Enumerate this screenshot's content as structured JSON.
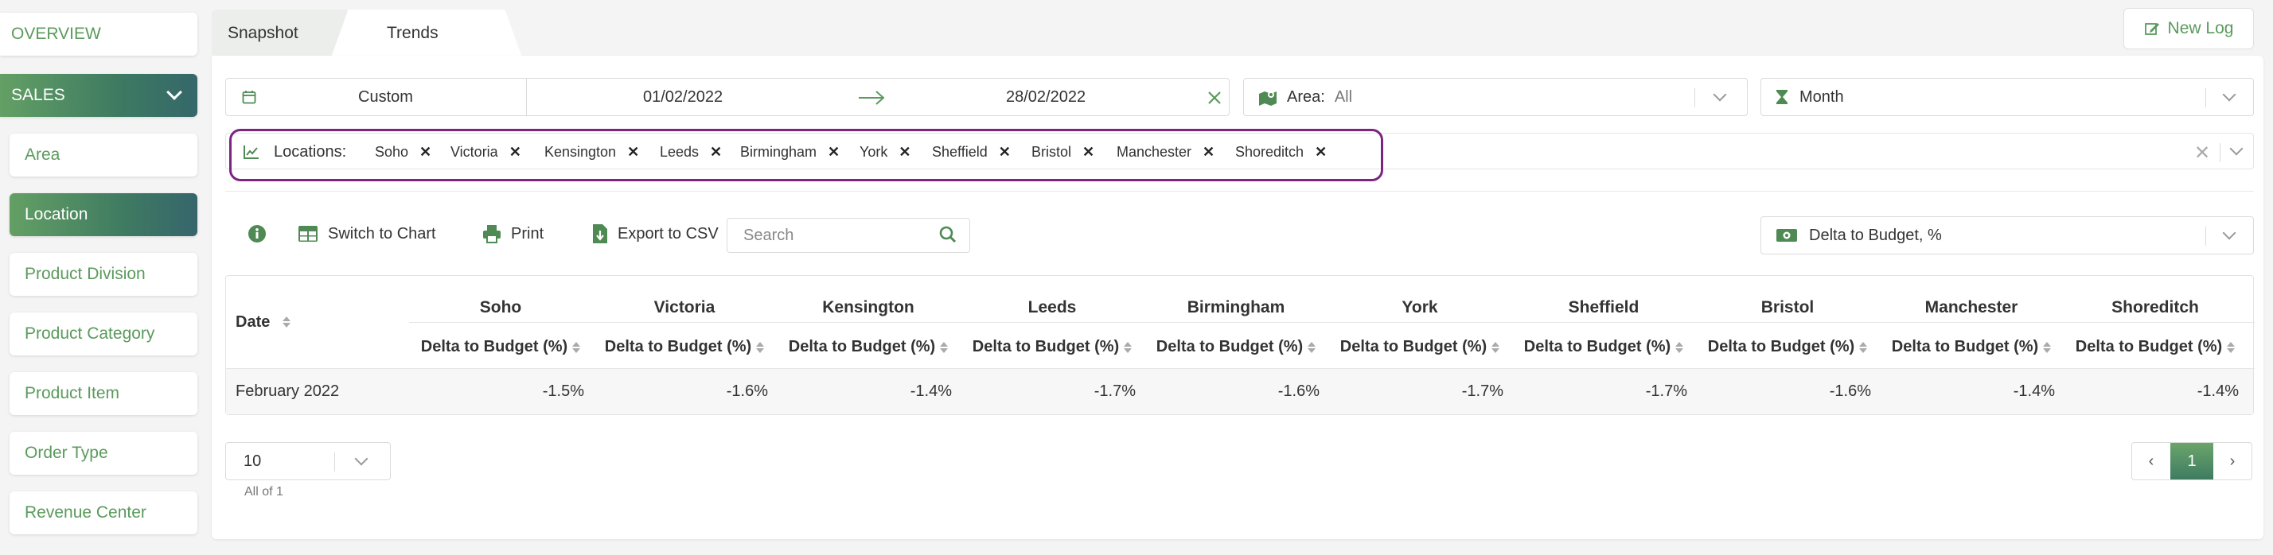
{
  "sidebar": {
    "items": [
      {
        "label": "OVERVIEW"
      },
      {
        "label": "SALES"
      },
      {
        "label": "Area"
      },
      {
        "label": "Location"
      },
      {
        "label": "Product Division"
      },
      {
        "label": "Product Category"
      },
      {
        "label": "Product Item"
      },
      {
        "label": "Order Type"
      },
      {
        "label": "Revenue Center"
      }
    ]
  },
  "tabs": [
    {
      "label": "Snapshot"
    },
    {
      "label": "Trends"
    }
  ],
  "new_log_label": "New Log",
  "filters": {
    "date_mode": "Custom",
    "date_from": "01/02/2022",
    "date_to": "28/02/2022",
    "area_label": "Area:",
    "area_value": "All",
    "period": "Month",
    "locations_label": "Locations:",
    "locations": [
      "Soho",
      "Victoria",
      "Kensington",
      "Leeds",
      "Birmingham",
      "York",
      "Sheffield",
      "Bristol",
      "Manchester",
      "Shoreditch"
    ]
  },
  "toolbar": {
    "switch_label": "Switch to Chart",
    "print_label": "Print",
    "export_label": "Export to CSV",
    "search_placeholder": "Search",
    "metric": "Delta to Budget, %"
  },
  "table": {
    "date_header": "Date",
    "columns": [
      "Soho",
      "Victoria",
      "Kensington",
      "Leeds",
      "Birmingham",
      "York",
      "Sheffield",
      "Bristol",
      "Manchester",
      "Shoreditch"
    ],
    "sub_header": "Delta to Budget (%)",
    "rows": [
      {
        "date": "February 2022",
        "values": [
          "-1.5%",
          "-1.6%",
          "-1.4%",
          "-1.7%",
          "-1.6%",
          "-1.7%",
          "-1.7%",
          "-1.6%",
          "-1.4%",
          "-1.4%"
        ]
      }
    ]
  },
  "pagination": {
    "page_size": "10",
    "summary": "All of 1",
    "prev": "‹",
    "current": "1",
    "next": "›"
  },
  "colors": {
    "accent": "#5a9a5c",
    "gradient_start": "#64a064",
    "gradient_end": "#36656c",
    "highlight": "#7b2580"
  }
}
